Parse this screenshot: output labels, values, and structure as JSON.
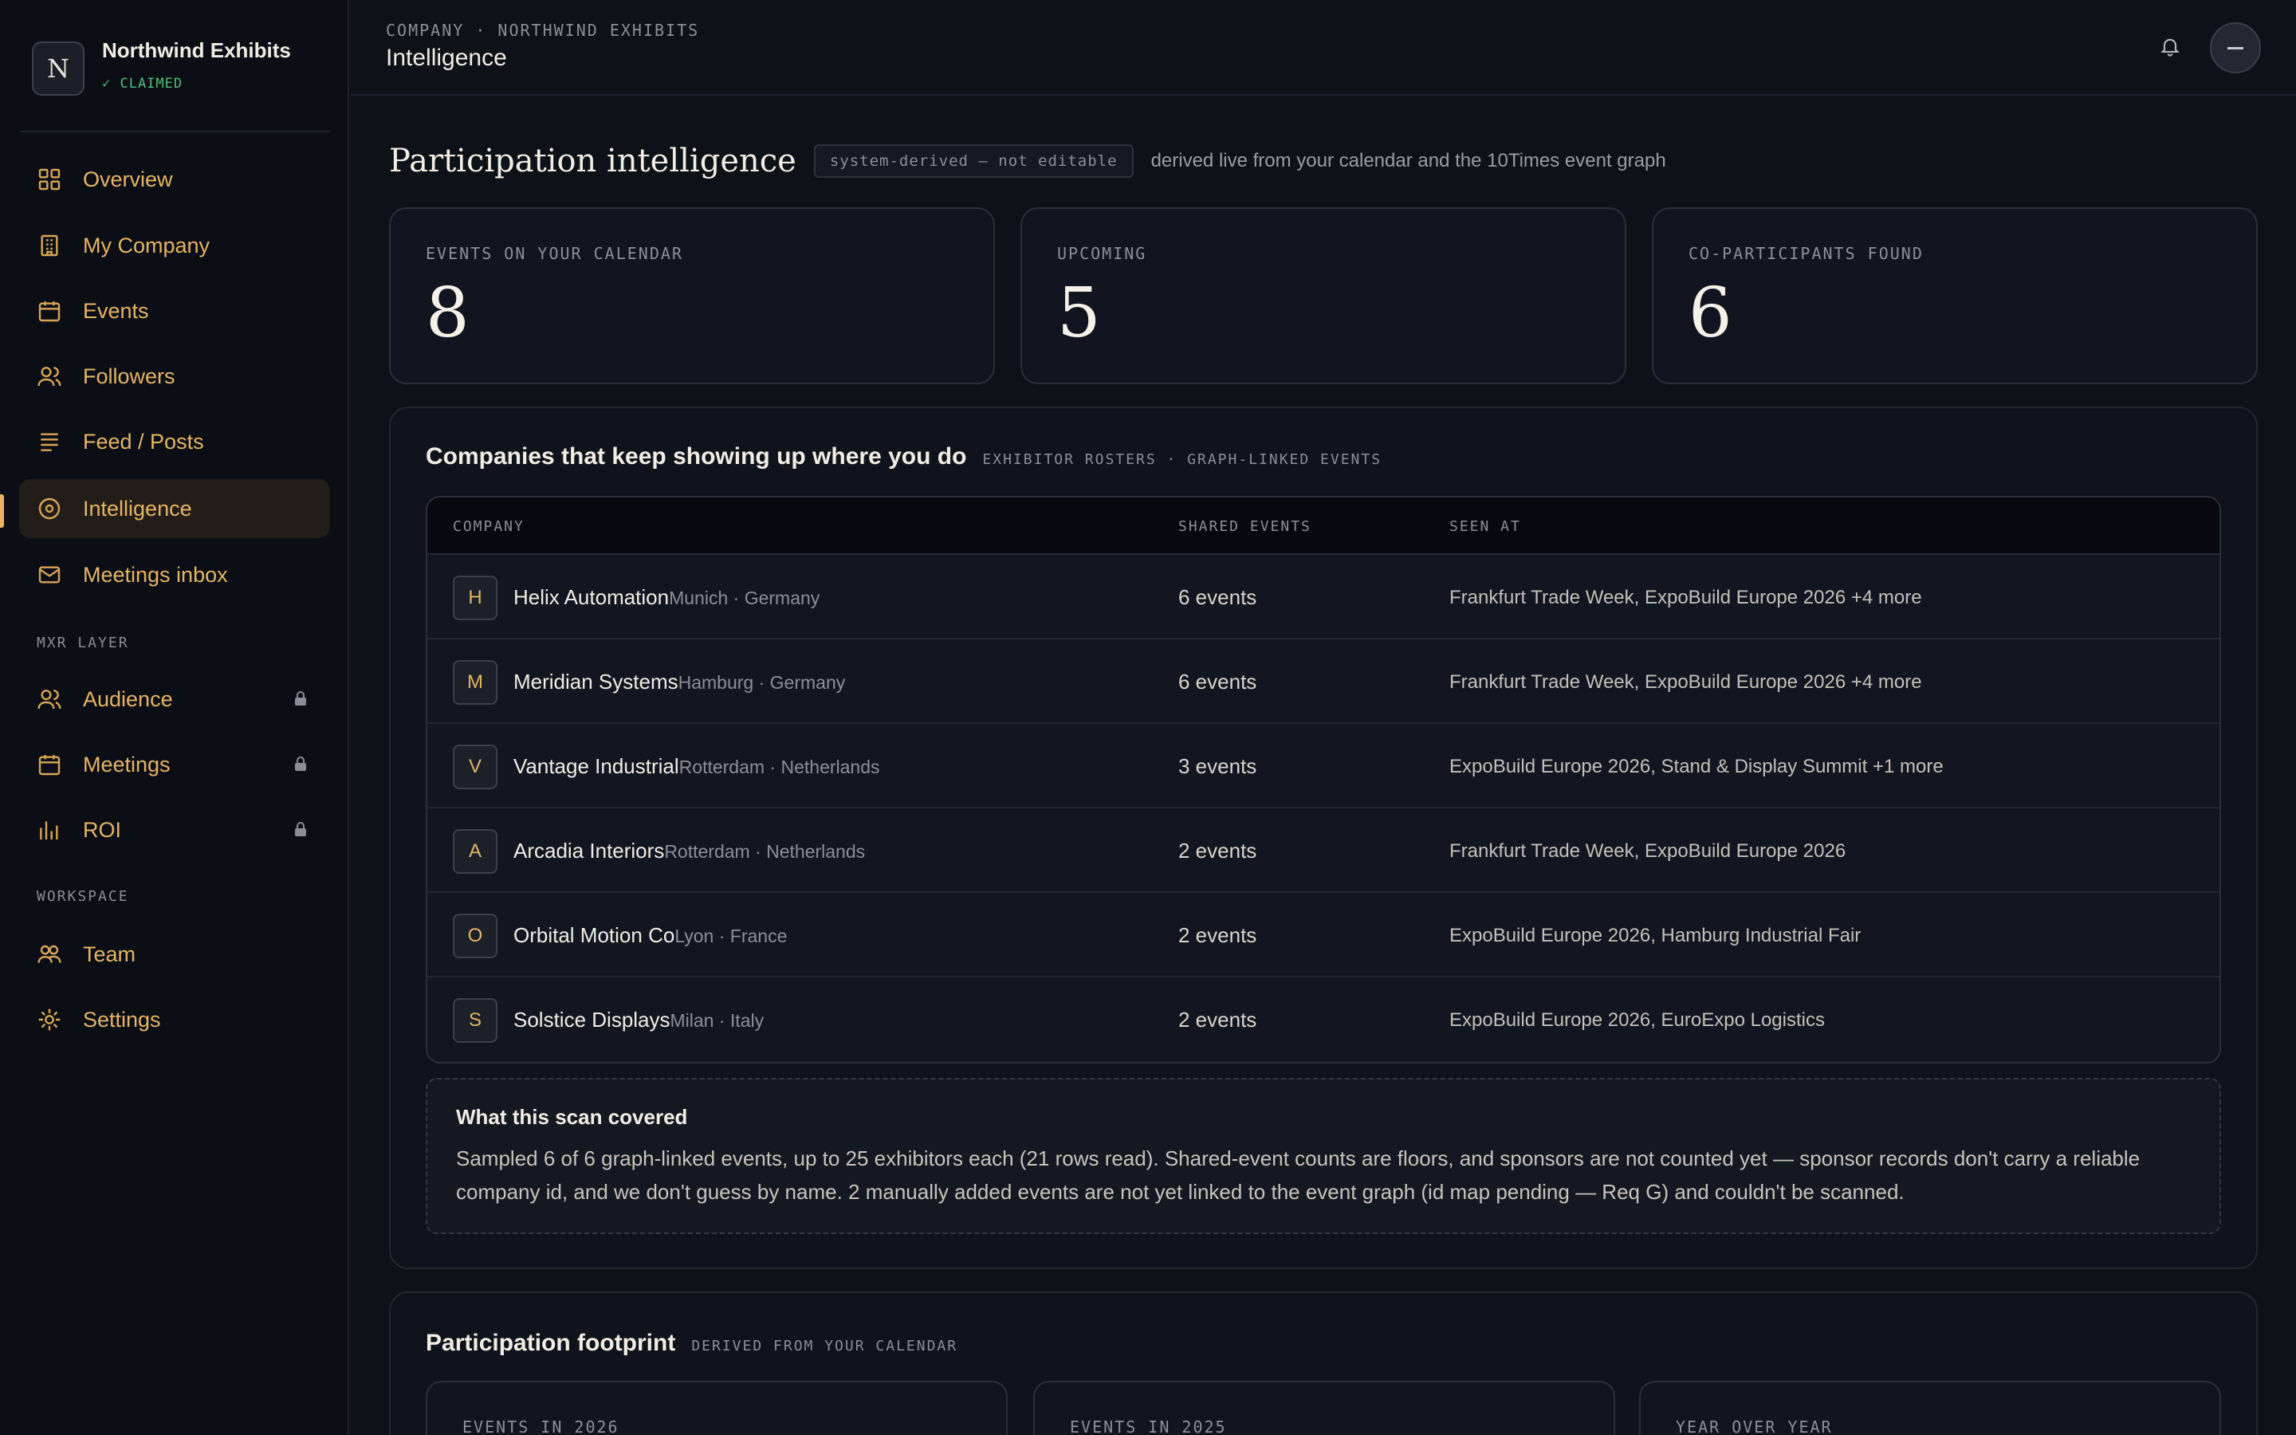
{
  "brand": {
    "initial": "N",
    "name": "Northwind Exhibits",
    "claim": "✓ CLAIMED"
  },
  "nav": {
    "main": [
      {
        "label": "Overview",
        "icon": "grid-icon"
      },
      {
        "label": "My Company",
        "icon": "building-icon"
      },
      {
        "label": "Events",
        "icon": "calendar-icon"
      },
      {
        "label": "Followers",
        "icon": "users-icon"
      },
      {
        "label": "Feed / Posts",
        "icon": "list-icon"
      },
      {
        "label": "Intelligence",
        "icon": "target-icon",
        "active": true
      },
      {
        "label": "Meetings inbox",
        "icon": "mail-icon"
      }
    ],
    "mxr_label": "MXR LAYER",
    "mxr": [
      {
        "label": "Audience",
        "icon": "users-icon",
        "locked": true
      },
      {
        "label": "Meetings",
        "icon": "calendar-icon",
        "locked": true
      },
      {
        "label": "ROI",
        "icon": "bar-chart-icon",
        "locked": true
      }
    ],
    "workspace_label": "WORKSPACE",
    "workspace": [
      {
        "label": "Team",
        "icon": "team-icon"
      },
      {
        "label": "Settings",
        "icon": "gear-icon"
      }
    ]
  },
  "header": {
    "breadcrumb": "COMPANY · NORTHWIND EXHIBITS",
    "title": "Intelligence"
  },
  "intel": {
    "title": "Participation intelligence",
    "badge": "system-derived — not editable",
    "description": "derived live from your calendar and the 10Times event graph"
  },
  "stats": [
    {
      "label": "EVENTS ON YOUR CALENDAR",
      "value": "8"
    },
    {
      "label": "UPCOMING",
      "value": "5"
    },
    {
      "label": "CO-PARTICIPANTS FOUND",
      "value": "6"
    }
  ],
  "companies": {
    "title": "Companies that keep showing up where you do",
    "subtitle": "EXHIBITOR ROSTERS · GRAPH-LINKED EVENTS",
    "columns": {
      "company": "COMPANY",
      "shared": "SHARED EVENTS",
      "seen": "SEEN AT"
    },
    "rows": [
      {
        "initial": "H",
        "name": "Helix Automation",
        "location": "Munich · Germany",
        "shared": "6 events",
        "seen": "Frankfurt Trade Week, ExpoBuild Europe 2026 +4 more"
      },
      {
        "initial": "M",
        "name": "Meridian Systems",
        "location": "Hamburg · Germany",
        "shared": "6 events",
        "seen": "Frankfurt Trade Week, ExpoBuild Europe 2026 +4 more"
      },
      {
        "initial": "V",
        "name": "Vantage Industrial",
        "location": "Rotterdam · Netherlands",
        "shared": "3 events",
        "seen": "ExpoBuild Europe 2026, Stand & Display Summit +1 more"
      },
      {
        "initial": "A",
        "name": "Arcadia Interiors",
        "location": "Rotterdam · Netherlands",
        "shared": "2 events",
        "seen": "Frankfurt Trade Week, ExpoBuild Europe 2026"
      },
      {
        "initial": "O",
        "name": "Orbital Motion Co",
        "location": "Lyon · France",
        "shared": "2 events",
        "seen": "ExpoBuild Europe 2026, Hamburg Industrial Fair"
      },
      {
        "initial": "S",
        "name": "Solstice Displays",
        "location": "Milan · Italy",
        "shared": "2 events",
        "seen": "ExpoBuild Europe 2026, EuroExpo Logistics"
      }
    ],
    "scan": {
      "title": "What this scan covered",
      "text": "Sampled 6 of 6 graph-linked events, up to 25 exhibitors each (21 rows read). Shared-event counts are floors, and sponsors are not counted yet — sponsor records don't carry a reliable company id, and we don't guess by name. 2 manually added events are not yet linked to the event graph (id map pending — Req G) and couldn't be scanned."
    }
  },
  "footprint": {
    "title": "Participation footprint",
    "subtitle": "DERIVED FROM YOUR CALENDAR",
    "cards": [
      {
        "label": "EVENTS IN 2026"
      },
      {
        "label": "EVENTS IN 2025"
      },
      {
        "label": "YEAR OVER YEAR"
      }
    ]
  },
  "colors": {
    "accent": "#e7b463",
    "claimed": "#4fbf7c",
    "background": "#0d1118"
  }
}
